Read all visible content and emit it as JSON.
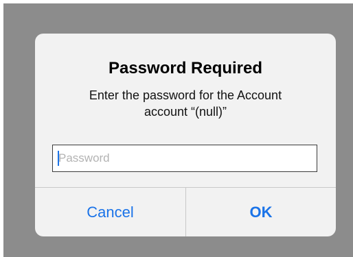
{
  "dialog": {
    "title": "Password Required",
    "message_line1": "Enter the password for the Account",
    "message_line2": "account “(null)”",
    "password_placeholder": "Password",
    "password_value": "",
    "cancel_label": "Cancel",
    "ok_label": "OK"
  },
  "colors": {
    "backdrop": "#8c8c8c",
    "dialog_background": "#f2f2f2",
    "accent": "#1a73e8",
    "divider": "#c8c8c8"
  }
}
